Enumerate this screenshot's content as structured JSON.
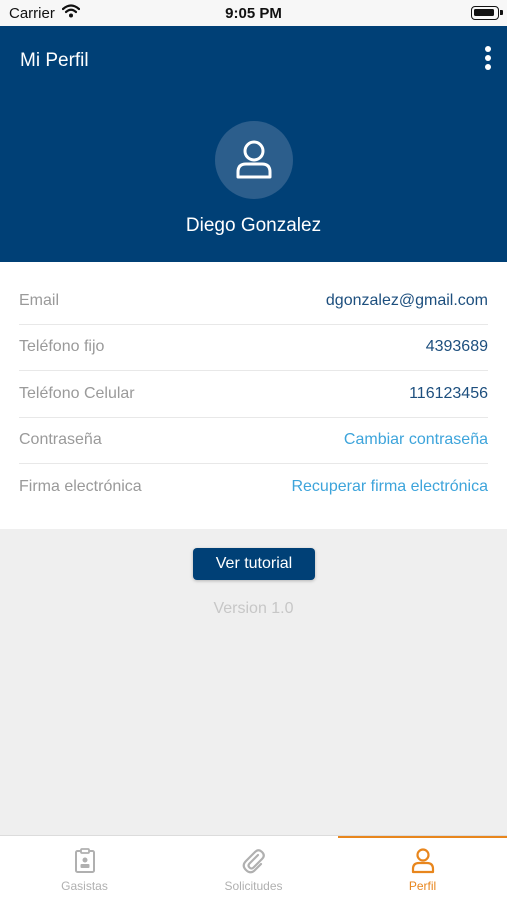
{
  "status_bar": {
    "carrier": "Carrier",
    "time": "9:05 PM"
  },
  "header": {
    "title": "Mi Perfil",
    "user_name": "Diego Gonzalez"
  },
  "profile_rows": [
    {
      "label": "Email",
      "value": "dgonzalez@gmail.com"
    },
    {
      "label": "Teléfono fijo",
      "value": "4393689"
    },
    {
      "label": "Teléfono Celular",
      "value": "116123456"
    },
    {
      "label": "Contraseña",
      "value": "Cambiar contraseña"
    },
    {
      "label": "Firma electrónica",
      "value": "Recuperar firma electrónica"
    }
  ],
  "tutorial_button": "Ver tutorial",
  "version": "Version 1.0",
  "tabs": [
    {
      "label": "Gasistas",
      "icon": "badge-icon",
      "active": false
    },
    {
      "label": "Solicitudes",
      "icon": "paperclip-icon",
      "active": false
    },
    {
      "label": "Perfil",
      "icon": "person-icon",
      "active": true
    }
  ],
  "colors": {
    "header": "#004076",
    "accent": "#e8861d",
    "link": "#3da4db"
  }
}
